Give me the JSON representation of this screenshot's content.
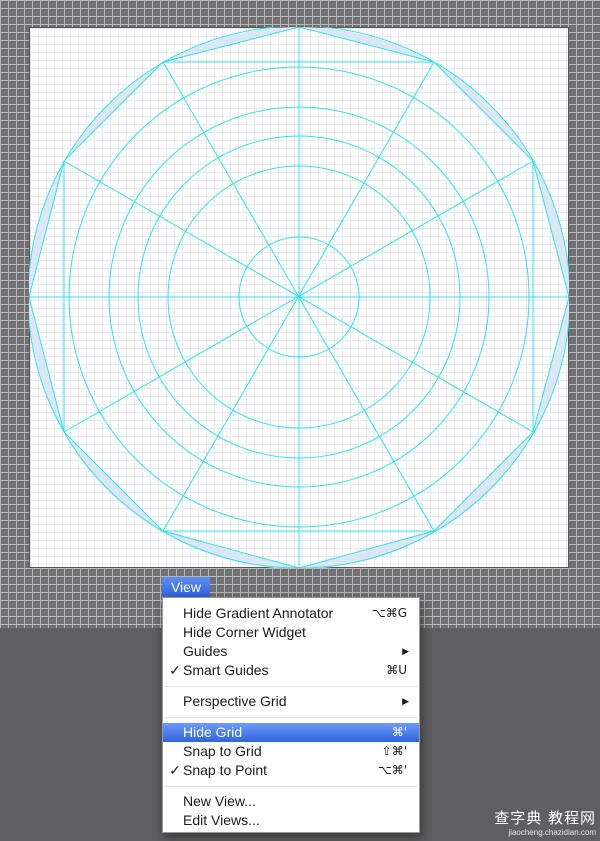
{
  "menubar": {
    "title": "View"
  },
  "menu": {
    "items": [
      {
        "label": "Hide Gradient Annotator",
        "shortcut": "⌥⌘G",
        "check": "",
        "arrow": ""
      },
      {
        "label": "Hide Corner Widget",
        "shortcut": "",
        "check": "",
        "arrow": ""
      },
      {
        "label": "Guides",
        "shortcut": "",
        "check": "",
        "arrow": "▶"
      },
      {
        "label": "Smart Guides",
        "shortcut": "⌘U",
        "check": "✓",
        "arrow": ""
      },
      {
        "label": "Perspective Grid",
        "shortcut": "",
        "check": "",
        "arrow": "▶"
      },
      {
        "label": "Hide Grid",
        "shortcut": "⌘'",
        "check": "",
        "arrow": ""
      },
      {
        "label": "Snap to Grid",
        "shortcut": "⇧⌘'",
        "check": "",
        "arrow": ""
      },
      {
        "label": "Snap to Point",
        "shortcut": "⌥⌘'",
        "check": "✓",
        "arrow": ""
      },
      {
        "label": "New View...",
        "shortcut": "",
        "check": "",
        "arrow": ""
      },
      {
        "label": "Edit Views...",
        "shortcut": "",
        "check": "",
        "arrow": ""
      }
    ],
    "highlighted": "Hide Grid"
  },
  "watermark": {
    "main": "查字典 教程网",
    "sub": "jiaocheng.chazidian.com"
  },
  "colors": {
    "guide": "#34e0ee",
    "fill": "#dce7f6",
    "highlight": "#3b6fe3"
  }
}
